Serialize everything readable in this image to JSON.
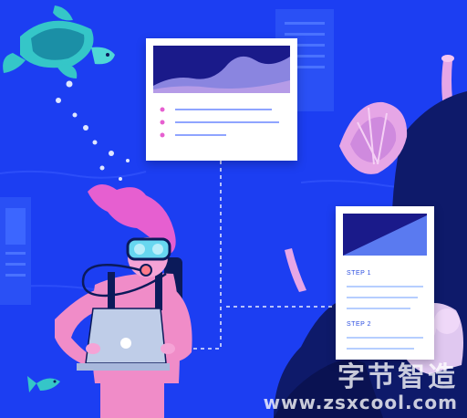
{
  "scene": {
    "colors": {
      "ocean": "#1c3ef2",
      "deep_rock": "#0e1a6a",
      "coral_pink": "#e6a6e6",
      "diver_skin": "#f08cc8",
      "mask": "#67d7f0",
      "hair": "#e65fd0",
      "laptop": "#bfcde8",
      "card": "#ffffff",
      "chart_navy": "#1a1a8a",
      "chart_wave": "#8a85e0"
    },
    "icons": [
      "turtle",
      "fish",
      "diver",
      "coral",
      "laptop"
    ]
  },
  "card_right": {
    "step1_label": "STEP 1",
    "step2_label": "STEP 2"
  },
  "watermark": {
    "cn_text": "字节智造",
    "url_text": "www.zsxcool.com"
  }
}
